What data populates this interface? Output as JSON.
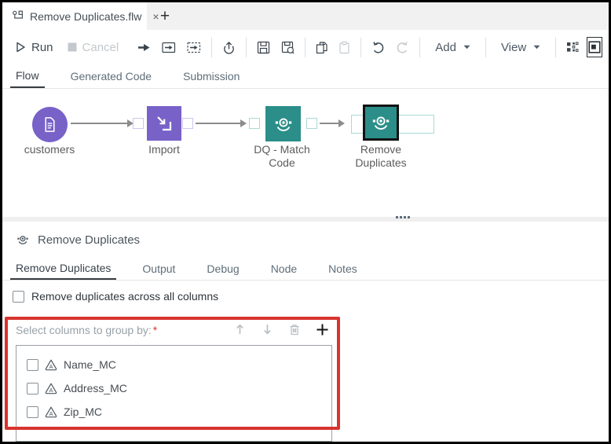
{
  "tab_bar": {
    "active_tab": {
      "title": "Remove Duplicates.flw",
      "close": "×"
    },
    "new_tab": "+"
  },
  "toolbar": {
    "run": "Run",
    "cancel": "Cancel",
    "add": "Add",
    "view": "View"
  },
  "flow_tabs": {
    "flow": "Flow",
    "generated_code": "Generated Code",
    "submission": "Submission"
  },
  "canvas": {
    "nodes": [
      {
        "label": "customers",
        "type": "table",
        "icon": "document-icon"
      },
      {
        "label": "Import",
        "icon": "import-icon"
      },
      {
        "label": "DQ - Match Code",
        "icon": "dq-icon"
      },
      {
        "label": "Remove Duplicates",
        "icon": "dq-icon",
        "selected": true
      }
    ]
  },
  "panel": {
    "title": "Remove Duplicates",
    "tabs": {
      "main": "Remove Duplicates",
      "output": "Output",
      "debug": "Debug",
      "node": "Node",
      "notes": "Notes"
    },
    "all_columns_checkbox": "Remove duplicates across all columns",
    "group_by": {
      "label": "Select columns to group by:",
      "required": "*",
      "columns": [
        {
          "name": "Name_MC",
          "type": "character"
        },
        {
          "name": "Address_MC",
          "type": "character"
        },
        {
          "name": "Zip_MC",
          "type": "character"
        }
      ]
    }
  },
  "colors": {
    "node_purple": "#7862c8",
    "node_teal": "#2b8e89",
    "annotation_red": "#d8342e",
    "icon_dark": "#39434c",
    "disabled_gray": "#c3c8cc"
  }
}
